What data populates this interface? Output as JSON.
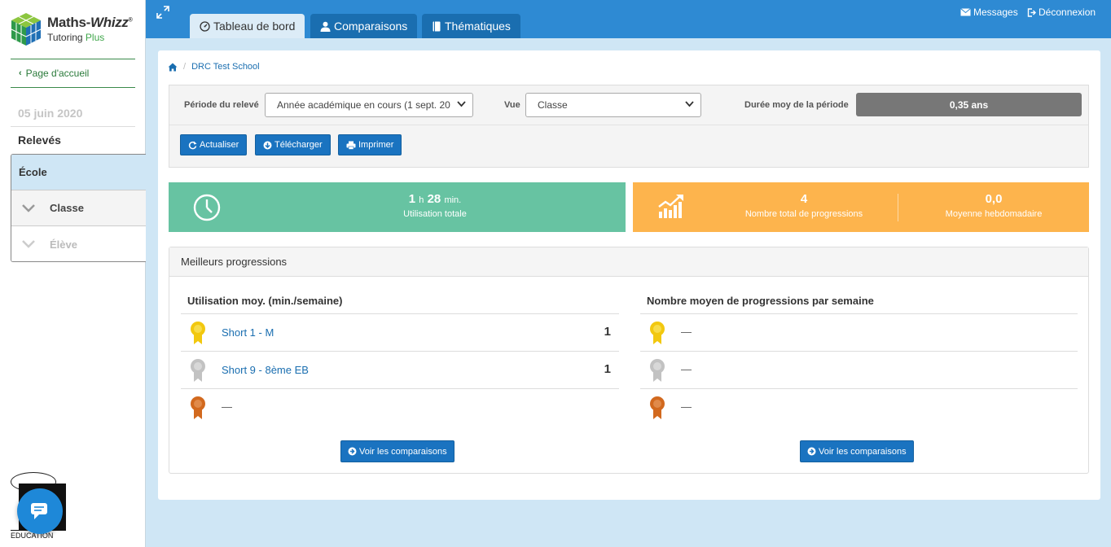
{
  "brand": {
    "title_main": "Maths-",
    "title_italic": "Whizz",
    "title_reg": "®",
    "subtitle_main": "Tutoring",
    "subtitle_accent": "Plus"
  },
  "sidebar": {
    "home_link": "Page d'accueil",
    "date": "05 juin 2020",
    "section_title": "Relevés",
    "nav": [
      {
        "label": "École"
      },
      {
        "label": "Classe"
      },
      {
        "label": "Élève"
      }
    ],
    "bottom_logo_text": "EDUCATION"
  },
  "topbar": {
    "tabs": [
      {
        "label": "Tableau de bord"
      },
      {
        "label": "Comparaisons"
      },
      {
        "label": "Thématiques"
      }
    ],
    "messages": "Messages",
    "logout": "Déconnexion"
  },
  "breadcrumb": {
    "school": "DRC Test School"
  },
  "filters": {
    "period_label": "Période du relevé",
    "period_value": "Année académique en cours (1 sept. 20",
    "view_label": "Vue",
    "view_value": "Classe",
    "duration_label": "Durée moy de la période",
    "duration_value": "0,35 ans",
    "buttons": {
      "refresh": "Actualiser",
      "download": "Télécharger",
      "print": "Imprimer"
    }
  },
  "stats": {
    "usage": {
      "hours": "1",
      "h_unit": "h",
      "minutes": "28",
      "min_unit": "min.",
      "label": "Utilisation totale"
    },
    "progressions": {
      "value": "4",
      "label": "Nombre total de progressions"
    },
    "weekly": {
      "value": "0,0",
      "label": "Moyenne hebdomadaire"
    }
  },
  "best": {
    "title": "Meilleurs progressions",
    "left": {
      "title": "Utilisation moy. (min./semaine)",
      "rows": [
        {
          "name": "Short 1 - M",
          "value": "1"
        },
        {
          "name": "Short 9 - 8ème EB",
          "value": "1"
        },
        {
          "name": "—",
          "value": ""
        }
      ],
      "button": "Voir les comparaisons"
    },
    "right": {
      "title": "Nombre moyen de progressions par semaine",
      "rows": [
        {
          "name": "—"
        },
        {
          "name": "—"
        },
        {
          "name": "—"
        }
      ],
      "button": "Voir les comparaisons"
    }
  },
  "colors": {
    "gold": "#f2c80f",
    "silver": "#c2c2c2",
    "bronze": "#d2691e",
    "stat_green": "#67c3a2",
    "stat_orange": "#fdb44d",
    "primary": "#1a73c0"
  }
}
